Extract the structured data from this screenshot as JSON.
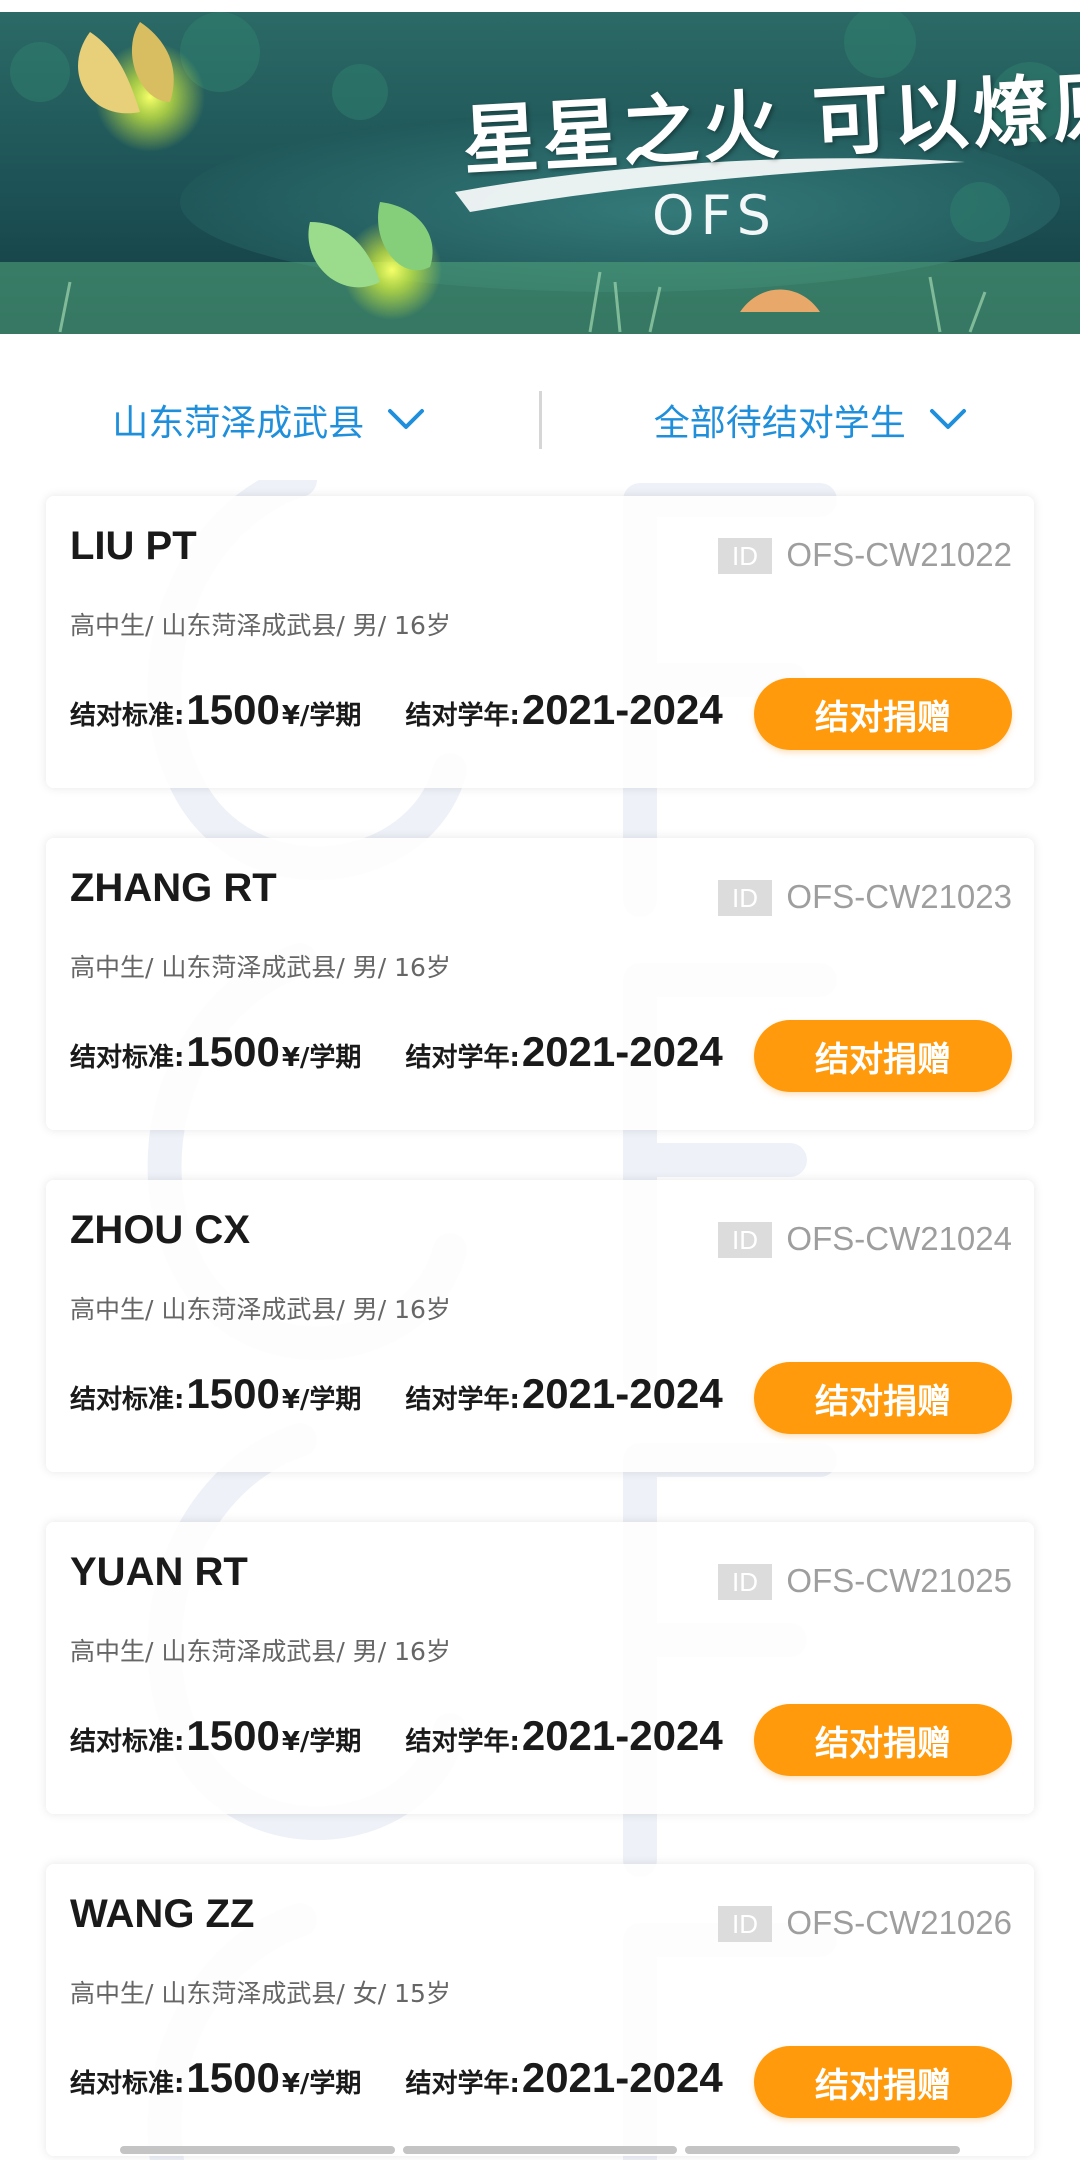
{
  "banner": {
    "slogan": "星星之火 可以燎原",
    "logo_text": "OFS"
  },
  "filters": {
    "region": "山东菏泽成武县",
    "student_filter": "全部待结对学生"
  },
  "labels": {
    "id_badge": "ID",
    "standard_label": "结对标准:",
    "standard_unit": "¥/学期",
    "years_label": "结对学年:",
    "donate_button": "结对捐赠"
  },
  "students": [
    {
      "name": "LIU PT",
      "id": "OFS-CW21022",
      "info": "高中生/ 山东菏泽成武县/ 男/ 16岁",
      "standard": "1500",
      "years": "2021-2024"
    },
    {
      "name": "ZHANG RT",
      "id": "OFS-CW21023",
      "info": "高中生/ 山东菏泽成武县/ 男/ 16岁",
      "standard": "1500",
      "years": "2021-2024"
    },
    {
      "name": "ZHOU CX",
      "id": "OFS-CW21024",
      "info": "高中生/ 山东菏泽成武县/ 男/ 16岁",
      "standard": "1500",
      "years": "2021-2024"
    },
    {
      "name": "YUAN RT",
      "id": "OFS-CW21025",
      "info": "高中生/ 山东菏泽成武县/ 男/ 16岁",
      "standard": "1500",
      "years": "2021-2024"
    },
    {
      "name": "WANG ZZ",
      "id": "OFS-CW21026",
      "info": "高中生/ 山东菏泽成武县/ 女/ 15岁",
      "standard": "1500",
      "years": "2021-2024"
    }
  ],
  "colors": {
    "accent_blue": "#1f8fdb",
    "donate_orange": "#ff9a0c",
    "banner_teal": "#1b4f55"
  }
}
